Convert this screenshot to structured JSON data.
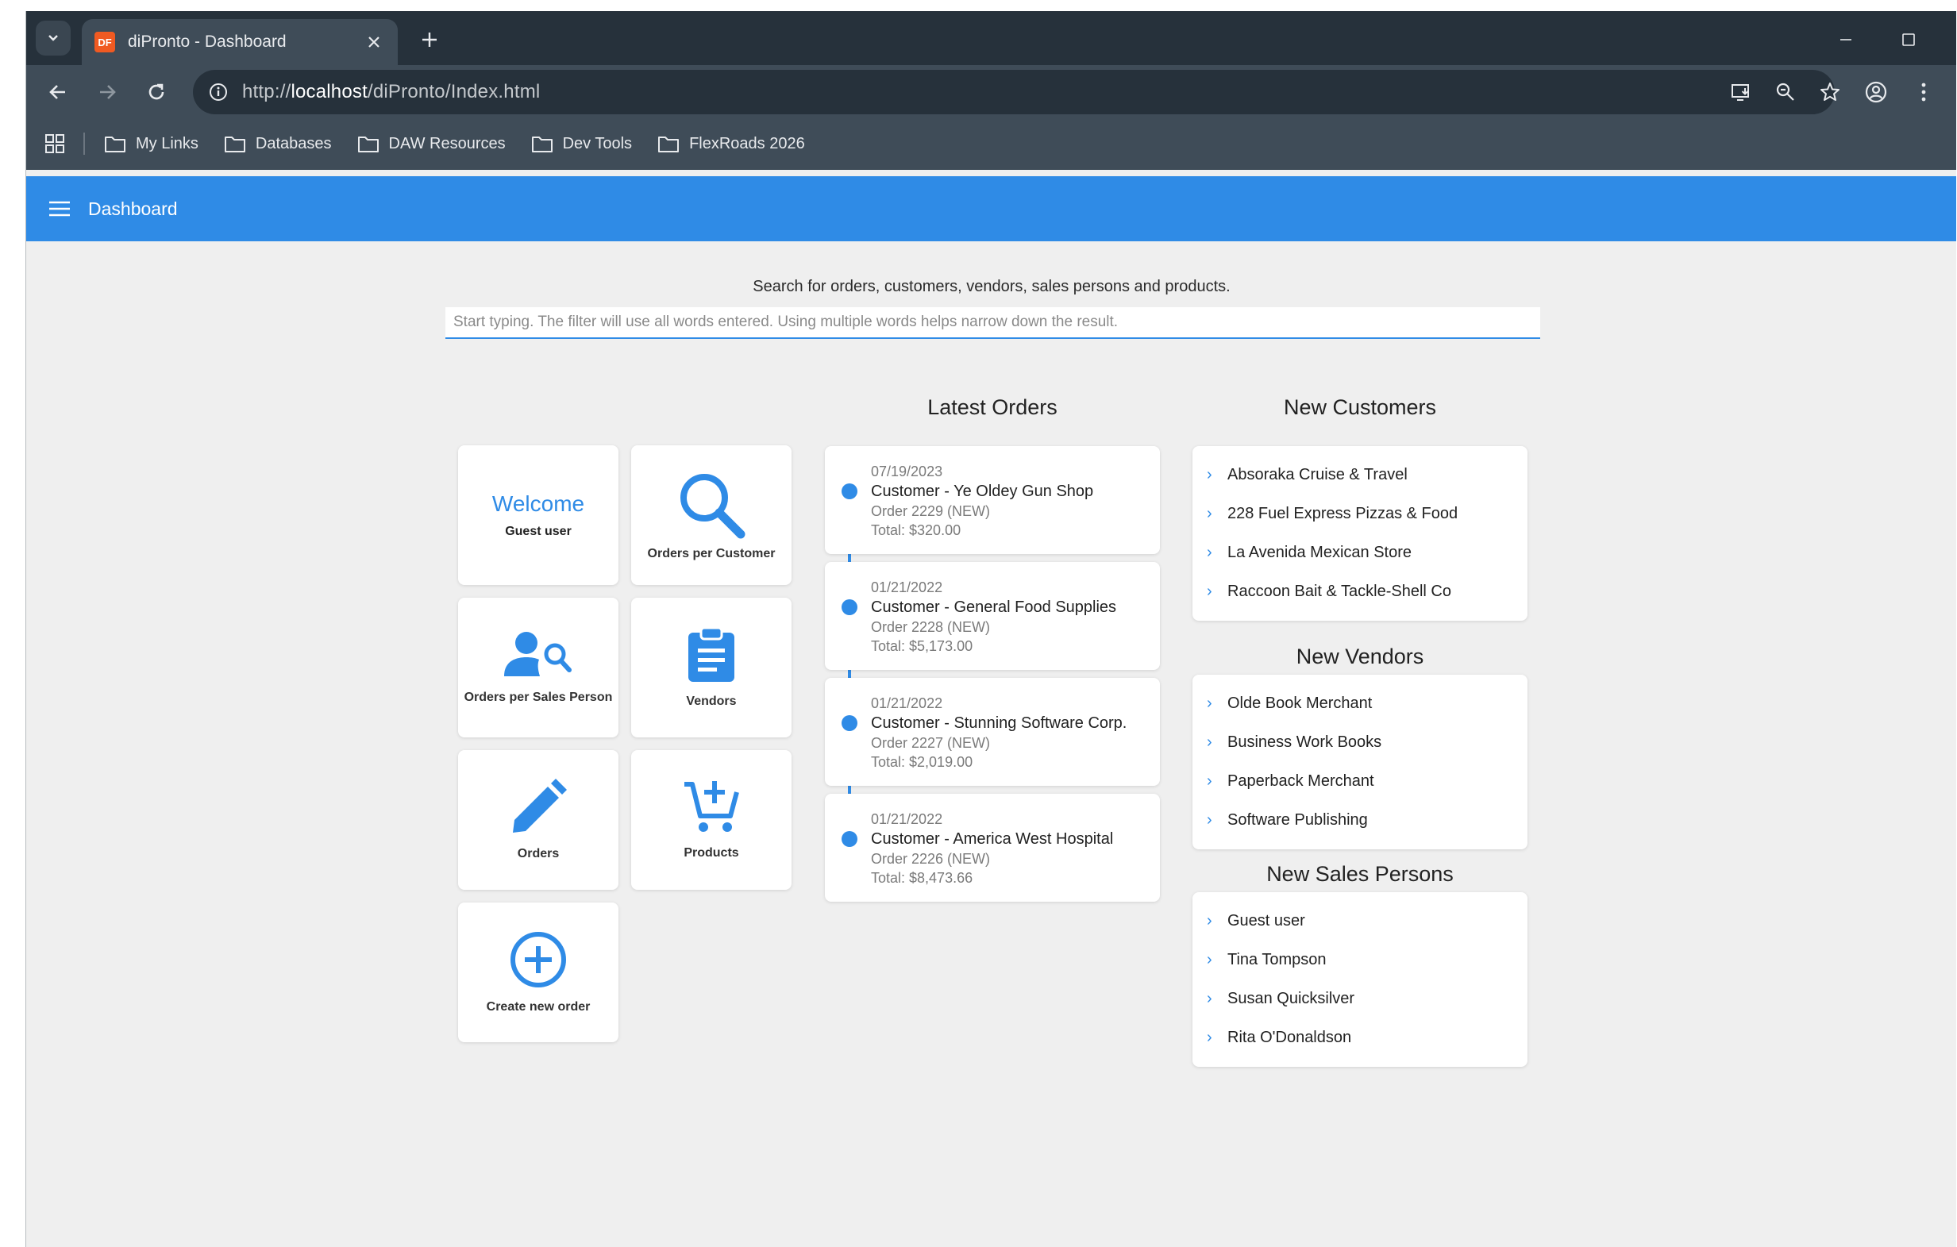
{
  "browser": {
    "tab_title": "diPronto - Dashboard",
    "favicon_text": "DF",
    "url_prefix": "http://",
    "url_host": "localhost",
    "url_path": "/diPronto/Index.html",
    "bookmarks": [
      "My Links",
      "Databases",
      "DAW Resources",
      "Dev Tools",
      "FlexRoads 2026"
    ]
  },
  "app": {
    "title": "Dashboard",
    "accent": "#2f8be6"
  },
  "search": {
    "label": "Search for orders, customers, vendors, sales persons and products.",
    "placeholder": "Start typing. The filter will use all words entered. Using multiple words helps narrow down the result."
  },
  "tiles": {
    "welcome_title": "Welcome",
    "welcome_user": "Guest user",
    "orders_per_customer": "Orders per Customer",
    "orders_per_sales_person": "Orders per Sales Person",
    "vendors": "Vendors",
    "orders": "Orders",
    "products": "Products",
    "create_new_order": "Create new order"
  },
  "latest_orders": {
    "title": "Latest Orders",
    "items": [
      {
        "date": "07/19/2023",
        "customer": "Customer - Ye Oldey Gun Shop",
        "order": "Order 2229 (NEW)",
        "total": "Total: $320.00"
      },
      {
        "date": "01/21/2022",
        "customer": "Customer - General Food Supplies",
        "order": "Order 2228 (NEW)",
        "total": "Total: $5,173.00"
      },
      {
        "date": "01/21/2022",
        "customer": "Customer - Stunning Software Corp.",
        "order": "Order 2227 (NEW)",
        "total": "Total: $2,019.00"
      },
      {
        "date": "01/21/2022",
        "customer": "Customer - America West Hospital",
        "order": "Order 2226 (NEW)",
        "total": "Total: $8,473.66"
      }
    ]
  },
  "new_customers": {
    "title": "New Customers",
    "items": [
      "Absoraka Cruise & Travel",
      "228 Fuel Express Pizzas & Food",
      "La Avenida Mexican Store",
      "Raccoon Bait & Tackle-Shell Co"
    ]
  },
  "new_vendors": {
    "title": "New Vendors",
    "items": [
      "Olde Book Merchant",
      "Business Work Books",
      "Paperback Merchant",
      "Software Publishing"
    ]
  },
  "new_sales_persons": {
    "title": "New Sales Persons",
    "items": [
      "Guest user",
      "Tina Tompson",
      "Susan Quicksilver",
      "Rita O'Donaldson"
    ]
  }
}
